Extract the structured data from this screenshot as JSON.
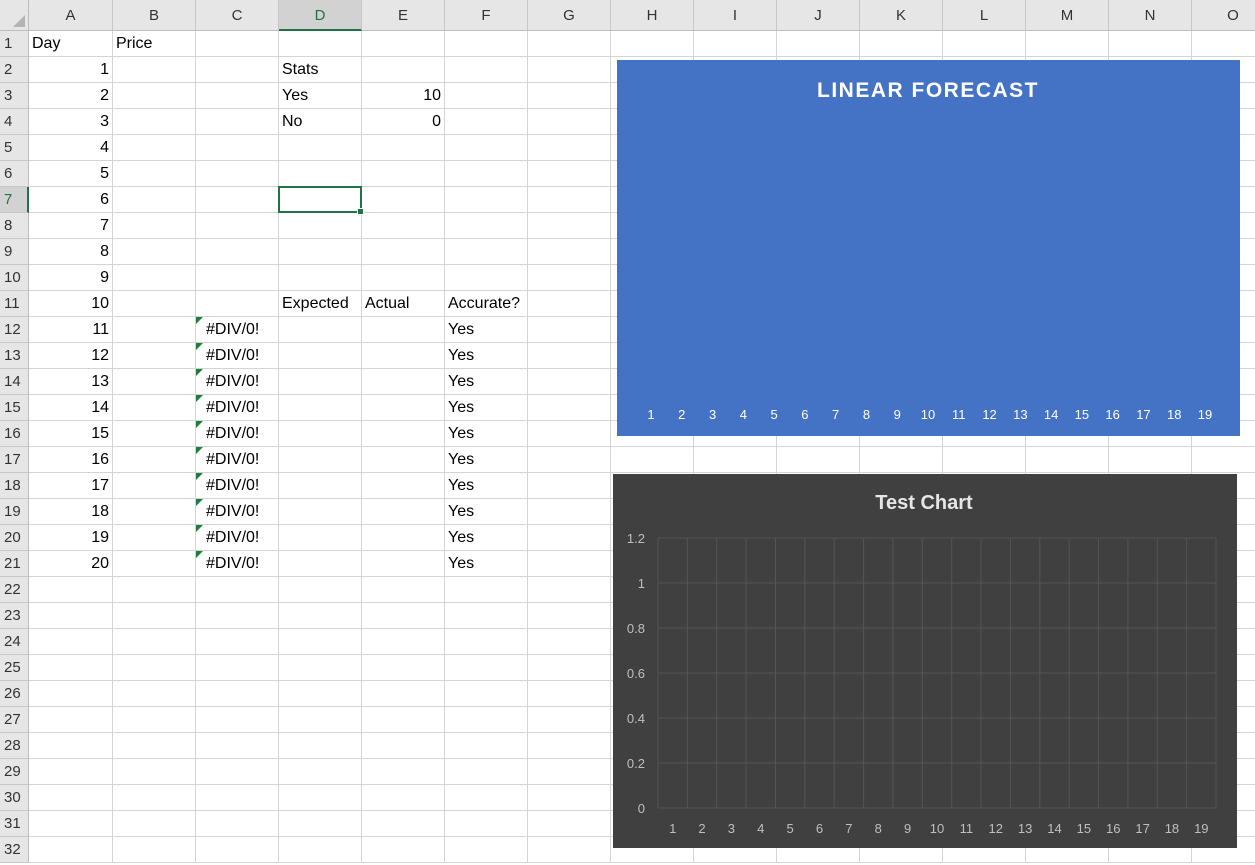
{
  "columns": [
    "A",
    "B",
    "C",
    "D",
    "E",
    "F",
    "G",
    "H",
    "I",
    "J",
    "K",
    "L",
    "M",
    "N",
    "O"
  ],
  "rows": [
    1,
    2,
    3,
    4,
    5,
    6,
    7,
    8,
    9,
    10,
    11,
    12,
    13,
    14,
    15,
    16,
    17,
    18,
    19,
    20,
    21,
    22,
    23,
    24,
    25,
    26,
    27,
    28,
    29,
    30,
    31,
    32
  ],
  "selected": {
    "column": "D",
    "row": 7
  },
  "cells": [
    {
      "ref": "A1",
      "value": "Day"
    },
    {
      "ref": "B1",
      "value": "Price"
    },
    {
      "ref": "A2",
      "value": "1",
      "num": true
    },
    {
      "ref": "A3",
      "value": "2",
      "num": true
    },
    {
      "ref": "A4",
      "value": "3",
      "num": true
    },
    {
      "ref": "A5",
      "value": "4",
      "num": true
    },
    {
      "ref": "A6",
      "value": "5",
      "num": true
    },
    {
      "ref": "A7",
      "value": "6",
      "num": true
    },
    {
      "ref": "A8",
      "value": "7",
      "num": true
    },
    {
      "ref": "A9",
      "value": "8",
      "num": true
    },
    {
      "ref": "A10",
      "value": "9",
      "num": true
    },
    {
      "ref": "A11",
      "value": "10",
      "num": true
    },
    {
      "ref": "A12",
      "value": "11",
      "num": true
    },
    {
      "ref": "A13",
      "value": "12",
      "num": true
    },
    {
      "ref": "A14",
      "value": "13",
      "num": true
    },
    {
      "ref": "A15",
      "value": "14",
      "num": true
    },
    {
      "ref": "A16",
      "value": "15",
      "num": true
    },
    {
      "ref": "A17",
      "value": "16",
      "num": true
    },
    {
      "ref": "A18",
      "value": "17",
      "num": true
    },
    {
      "ref": "A19",
      "value": "18",
      "num": true
    },
    {
      "ref": "A20",
      "value": "19",
      "num": true
    },
    {
      "ref": "A21",
      "value": "20",
      "num": true
    },
    {
      "ref": "D2",
      "value": "Stats"
    },
    {
      "ref": "D3",
      "value": "Yes"
    },
    {
      "ref": "E3",
      "value": "10",
      "num": true
    },
    {
      "ref": "D4",
      "value": "No"
    },
    {
      "ref": "E4",
      "value": "0",
      "num": true
    },
    {
      "ref": "D11",
      "value": "Expected"
    },
    {
      "ref": "E11",
      "value": "Actual"
    },
    {
      "ref": "F11",
      "value": "Accurate?"
    },
    {
      "ref": "C12",
      "value": "#DIV/0!",
      "err": true
    },
    {
      "ref": "C13",
      "value": "#DIV/0!",
      "err": true
    },
    {
      "ref": "C14",
      "value": "#DIV/0!",
      "err": true
    },
    {
      "ref": "C15",
      "value": "#DIV/0!",
      "err": true
    },
    {
      "ref": "C16",
      "value": "#DIV/0!",
      "err": true
    },
    {
      "ref": "C17",
      "value": "#DIV/0!",
      "err": true
    },
    {
      "ref": "C18",
      "value": "#DIV/0!",
      "err": true
    },
    {
      "ref": "C19",
      "value": "#DIV/0!",
      "err": true
    },
    {
      "ref": "C20",
      "value": "#DIV/0!",
      "err": true
    },
    {
      "ref": "C21",
      "value": "#DIV/0!",
      "err": true
    },
    {
      "ref": "F12",
      "value": "Yes"
    },
    {
      "ref": "F13",
      "value": "Yes"
    },
    {
      "ref": "F14",
      "value": "Yes"
    },
    {
      "ref": "F15",
      "value": "Yes"
    },
    {
      "ref": "F16",
      "value": "Yes"
    },
    {
      "ref": "F17",
      "value": "Yes"
    },
    {
      "ref": "F18",
      "value": "Yes"
    },
    {
      "ref": "F19",
      "value": "Yes"
    },
    {
      "ref": "F20",
      "value": "Yes"
    },
    {
      "ref": "F21",
      "value": "Yes"
    }
  ],
  "colors": {
    "error_indicator": "#1e7d3a",
    "selection": "#217346",
    "chart1_bg": "#4472c4",
    "chart2_bg": "#404040"
  },
  "chart_data": [
    {
      "type": "line",
      "title": "LINEAR FORECAST",
      "categories": [
        "1",
        "2",
        "3",
        "4",
        "5",
        "6",
        "7",
        "8",
        "9",
        "10",
        "11",
        "12",
        "13",
        "14",
        "15",
        "16",
        "17",
        "18",
        "19"
      ],
      "series": [],
      "grid": false
    },
    {
      "type": "line",
      "title": "Test Chart",
      "categories": [
        "1",
        "2",
        "3",
        "4",
        "5",
        "6",
        "7",
        "8",
        "9",
        "10",
        "11",
        "12",
        "13",
        "14",
        "15",
        "16",
        "17",
        "18",
        "19"
      ],
      "y_ticks": [
        "0",
        "0.2",
        "0.4",
        "0.6",
        "0.8",
        "1",
        "1.2"
      ],
      "ylim": [
        0,
        1.2
      ],
      "series": [],
      "grid": true
    }
  ]
}
